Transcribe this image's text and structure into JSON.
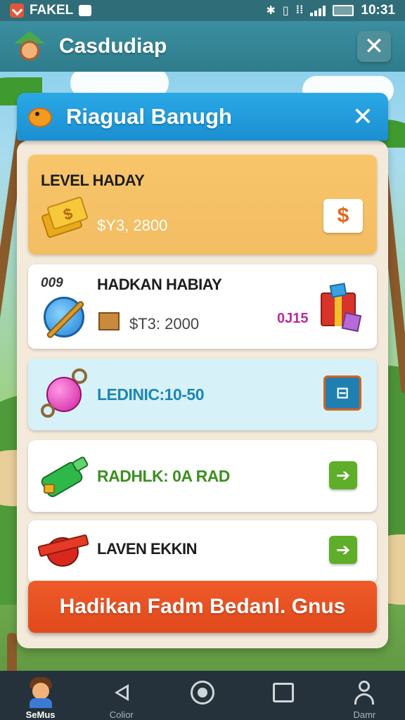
{
  "status_bar": {
    "app_label": "FAKEL",
    "time": "10:31",
    "bluetooth_glyph": "✱",
    "vibrate_glyph": "▯",
    "vibrate_glyph2": "⁞⁞"
  },
  "header": {
    "title": "Casdudiap",
    "close_glyph": "✕"
  },
  "panel": {
    "title": "Riagual Banugh",
    "close_glyph": "✕",
    "cards": [
      {
        "title": "LEVEL HADAY",
        "value": "$Y3, 2800",
        "button_label": "$"
      },
      {
        "badge": "009",
        "title": "HADKAN HABIAY",
        "value": "$T3: 2000",
        "tag": "0J15"
      },
      {
        "title": "LEDINIC:10-50",
        "button_label": "⊟"
      },
      {
        "title": "RADHLK: 0A RAD",
        "button_label": "➔"
      },
      {
        "title": "LAVEN EKKIN",
        "button_label": "➔"
      }
    ],
    "action_label": "Hadikan Fadm Bedanl. Gnus"
  },
  "bottom_nav": {
    "items": [
      {
        "label": "SeMus"
      },
      {
        "label": "Colior"
      },
      {
        "label": ""
      },
      {
        "label": ""
      },
      {
        "label": "Damr"
      }
    ]
  },
  "colors": {
    "header_bg": "#2e7c8c",
    "panel_header": "#1b8fd1",
    "action_button": "#e14a1c",
    "gold_card": "#f3bd63",
    "cyan_card": "#d6f1f8",
    "nav_bg": "#26323b"
  },
  "icons": {
    "header_avatar": "villager-house-icon",
    "panel_icon": "bird-icon",
    "card1": "gold-bars-icon",
    "card2": "magic-orb-icon",
    "card2_small": "crate-icon",
    "card2_right": "gift-box-icon",
    "card3": "pink-gem-icon",
    "card4": "green-bottle-icon",
    "card5": "ribbon-heart-icon"
  }
}
